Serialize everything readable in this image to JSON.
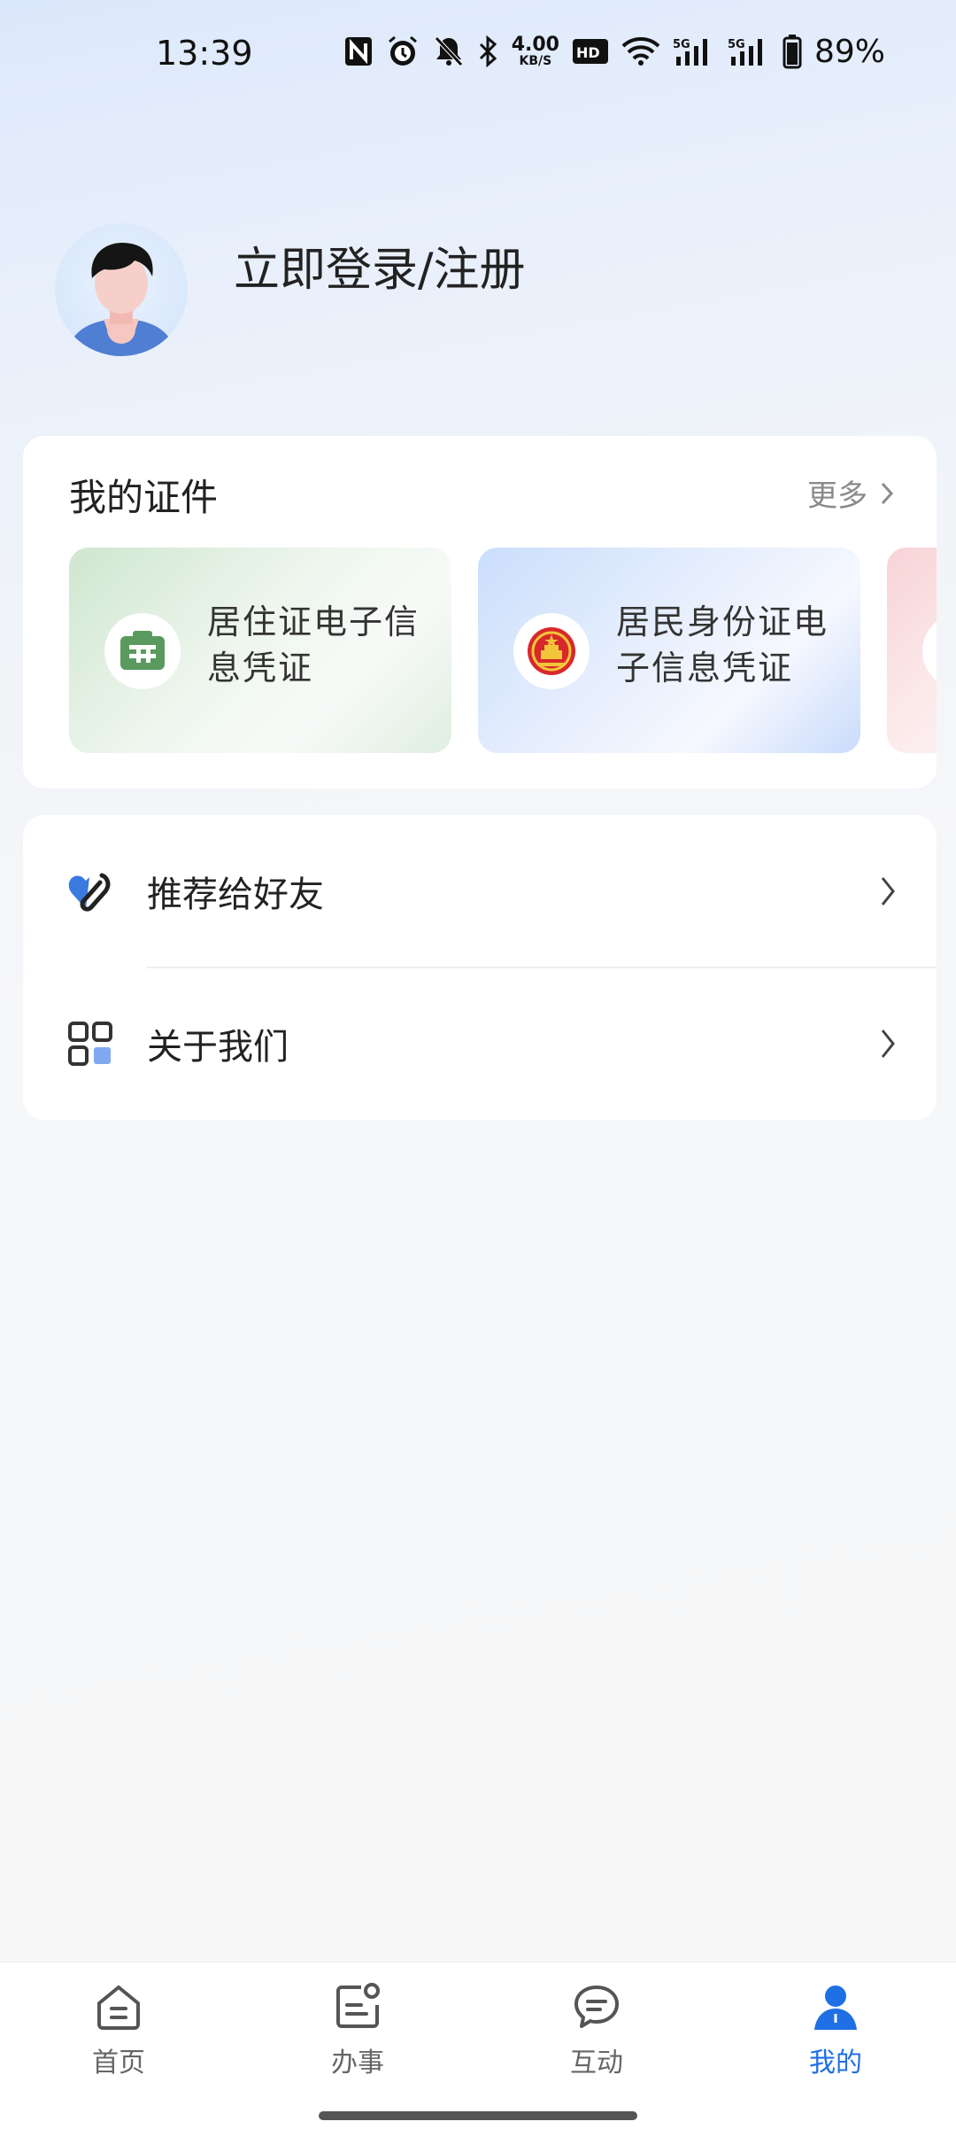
{
  "status_bar": {
    "time": "13:39",
    "net_speed_value": "4.00",
    "net_speed_unit": "KB/S",
    "battery_percent": "89%",
    "icons": [
      "nfc-icon",
      "alarm-icon",
      "mute-icon",
      "bluetooth-icon",
      "hd-icon",
      "wifi-icon",
      "signal-5g-icon",
      "signal-5g-icon",
      "battery-icon"
    ]
  },
  "profile": {
    "login_text": "立即登录/注册"
  },
  "certificates": {
    "title": "我的证件",
    "more_label": "更多",
    "items": [
      {
        "label": "居住证电子信息凭证",
        "icon": "residence-permit-icon",
        "color": "#5a9a5e"
      },
      {
        "label": "居民身份证电子信息凭证",
        "icon": "national-emblem-icon",
        "color": "#d8282b"
      },
      {
        "label": "",
        "icon": "card-icon",
        "color": "#e88a90"
      }
    ]
  },
  "menu": {
    "items": [
      {
        "label": "推荐给好友",
        "icon": "heart-share-icon"
      },
      {
        "label": "关于我们",
        "icon": "grid-apps-icon"
      }
    ]
  },
  "bottom_nav": {
    "items": [
      {
        "label": "首页",
        "icon": "home-icon",
        "active": false
      },
      {
        "label": "办事",
        "icon": "service-icon",
        "active": false
      },
      {
        "label": "互动",
        "icon": "chat-icon",
        "active": false
      },
      {
        "label": "我的",
        "icon": "person-icon",
        "active": true
      }
    ],
    "active_color": "#1f6fe5"
  }
}
